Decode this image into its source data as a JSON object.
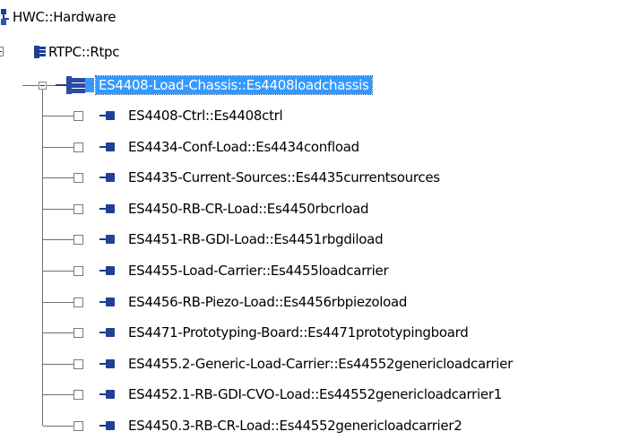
{
  "tree": {
    "root": {
      "label": "HWC::Hardware",
      "icon": "hardware-tree-icon"
    },
    "rtpc": {
      "label": "RTPC::Rtpc",
      "icon": "rtpc-icon"
    },
    "chassis": {
      "label": "ES4408-Load-Chassis::Es4408loadchassis",
      "icon": "chassis-icon",
      "selected": true
    },
    "children": [
      {
        "label": "ES4408-Ctrl::Es4408ctrl"
      },
      {
        "label": "ES4434-Conf-Load::Es4434confload"
      },
      {
        "label": "ES4435-Current-Sources::Es4435currentsources"
      },
      {
        "label": "ES4450-RB-CR-Load::Es4450rbcrload"
      },
      {
        "label": "ES4451-RB-GDI-Load::Es4451rbgdiload"
      },
      {
        "label": "ES4455-Load-Carrier::Es4455loadcarrier"
      },
      {
        "label": "ES4456-RB-Piezo-Load::Es4456rbpiezoload"
      },
      {
        "label": "ES4471-Prototyping-Board::Es4471prototypingboard"
      },
      {
        "label": "ES4455.2-Generic-Load-Carrier::Es44552genericloadcarrier"
      },
      {
        "label": "ES4452.1-RB-GDI-CVO-Load::Es44552genericloadcarrier1"
      },
      {
        "label": "ES4450.3-RB-CR-Load::Es44552genericloadcarrier2"
      }
    ]
  },
  "colors": {
    "selection": "#3399ff",
    "module_icon": "#233f95",
    "tree_lines": "#6f6f6f"
  }
}
